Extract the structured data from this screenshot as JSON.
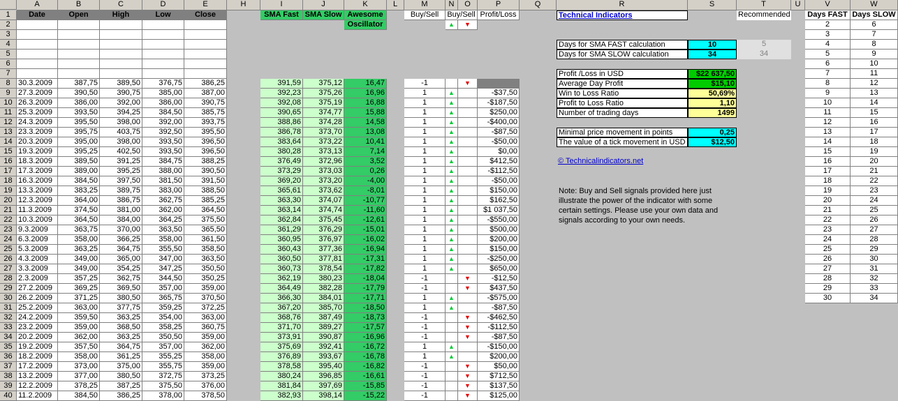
{
  "column_letters": [
    "A",
    "B",
    "C",
    "D",
    "E",
    "",
    "H",
    "I",
    "J",
    "K",
    "L",
    "M",
    "N",
    "O",
    "P",
    "Q",
    "R",
    "S",
    "T",
    "U",
    "V",
    "W"
  ],
  "price_headers": [
    "Date",
    "Open",
    "High",
    "Low",
    "Close"
  ],
  "indicator_headers": {
    "sma_fast": "SMA Fast",
    "sma_slow": "SMA Slow",
    "ao_line1": "Awesome",
    "ao_line2": "Oscillator",
    "buy_sell": "Buy/Sell",
    "buy_sell2": "Buy/Sell",
    "profit_loss": "Profit/Loss"
  },
  "days_headers": {
    "fast": "Days FAST",
    "slow": "Days SLOW"
  },
  "rows": [
    {
      "date": "30.3.2009",
      "open": "387,75",
      "high": "389,50",
      "low": "376,75",
      "close": "386,25",
      "fast": "391,59",
      "slow": "375,12",
      "ao": "16,47",
      "bs": "-1",
      "sig": "dn",
      "pl": ""
    },
    {
      "date": "27.3.2009",
      "open": "390,50",
      "high": "390,75",
      "low": "385,00",
      "close": "387,00",
      "fast": "392,23",
      "slow": "375,26",
      "ao": "16,96",
      "bs": "1",
      "sig": "up",
      "pl": "-$37,50"
    },
    {
      "date": "26.3.2009",
      "open": "386,00",
      "high": "392,00",
      "low": "386,00",
      "close": "390,75",
      "fast": "392,08",
      "slow": "375,19",
      "ao": "16,88",
      "bs": "1",
      "sig": "up",
      "pl": "-$187,50"
    },
    {
      "date": "25.3.2009",
      "open": "393,50",
      "high": "394,25",
      "low": "384,50",
      "close": "385,75",
      "fast": "390,65",
      "slow": "374,77",
      "ao": "15,88",
      "bs": "1",
      "sig": "up",
      "pl": "$250,00"
    },
    {
      "date": "24.3.2009",
      "open": "395,50",
      "high": "398,00",
      "low": "392,00",
      "close": "393,75",
      "fast": "388,86",
      "slow": "374,28",
      "ao": "14,58",
      "bs": "1",
      "sig": "up",
      "pl": "-$400,00"
    },
    {
      "date": "23.3.2009",
      "open": "395,75",
      "high": "403,75",
      "low": "392,50",
      "close": "395,50",
      "fast": "386,78",
      "slow": "373,70",
      "ao": "13,08",
      "bs": "1",
      "sig": "up",
      "pl": "-$87,50"
    },
    {
      "date": "20.3.2009",
      "open": "395,00",
      "high": "398,00",
      "low": "393,50",
      "close": "396,50",
      "fast": "383,64",
      "slow": "373,22",
      "ao": "10,41",
      "bs": "1",
      "sig": "up",
      "pl": "-$50,00"
    },
    {
      "date": "19.3.2009",
      "open": "395,25",
      "high": "402,50",
      "low": "393,50",
      "close": "396,50",
      "fast": "380,28",
      "slow": "373,13",
      "ao": "7,14",
      "bs": "1",
      "sig": "up",
      "pl": "$0,00"
    },
    {
      "date": "18.3.2009",
      "open": "389,50",
      "high": "391,25",
      "low": "384,75",
      "close": "388,25",
      "fast": "376,49",
      "slow": "372,96",
      "ao": "3,52",
      "bs": "1",
      "sig": "up",
      "pl": "$412,50"
    },
    {
      "date": "17.3.2009",
      "open": "389,00",
      "high": "395,25",
      "low": "388,00",
      "close": "390,50",
      "fast": "373,29",
      "slow": "373,03",
      "ao": "0,26",
      "bs": "1",
      "sig": "up",
      "pl": "-$112,50"
    },
    {
      "date": "16.3.2009",
      "open": "384,50",
      "high": "397,50",
      "low": "381,50",
      "close": "391,50",
      "fast": "369,20",
      "slow": "373,20",
      "ao": "-4,00",
      "bs": "1",
      "sig": "up",
      "pl": "-$50,00"
    },
    {
      "date": "13.3.2009",
      "open": "383,25",
      "high": "389,75",
      "low": "383,00",
      "close": "388,50",
      "fast": "365,61",
      "slow": "373,62",
      "ao": "-8,01",
      "bs": "1",
      "sig": "up",
      "pl": "$150,00"
    },
    {
      "date": "12.3.2009",
      "open": "364,00",
      "high": "386,75",
      "low": "362,75",
      "close": "385,25",
      "fast": "363,30",
      "slow": "374,07",
      "ao": "-10,77",
      "bs": "1",
      "sig": "up",
      "pl": "$162,50"
    },
    {
      "date": "11.3.2009",
      "open": "374,50",
      "high": "381,00",
      "low": "362,00",
      "close": "364,50",
      "fast": "363,14",
      "slow": "374,74",
      "ao": "-11,60",
      "bs": "1",
      "sig": "up",
      "pl": "$1 037,50"
    },
    {
      "date": "10.3.2009",
      "open": "364,50",
      "high": "384,00",
      "low": "364,25",
      "close": "375,50",
      "fast": "362,84",
      "slow": "375,45",
      "ao": "-12,61",
      "bs": "1",
      "sig": "up",
      "pl": "-$550,00"
    },
    {
      "date": "9.3.2009",
      "open": "363,75",
      "high": "370,00",
      "low": "363,50",
      "close": "365,50",
      "fast": "361,29",
      "slow": "376,29",
      "ao": "-15,01",
      "bs": "1",
      "sig": "up",
      "pl": "$500,00"
    },
    {
      "date": "6.3.2009",
      "open": "358,00",
      "high": "366,25",
      "low": "358,00",
      "close": "361,50",
      "fast": "360,95",
      "slow": "376,97",
      "ao": "-16,02",
      "bs": "1",
      "sig": "up",
      "pl": "$200,00"
    },
    {
      "date": "5.3.2009",
      "open": "363,25",
      "high": "364,75",
      "low": "355,50",
      "close": "358,50",
      "fast": "360,43",
      "slow": "377,36",
      "ao": "-16,94",
      "bs": "1",
      "sig": "up",
      "pl": "$150,00"
    },
    {
      "date": "4.3.2009",
      "open": "349,00",
      "high": "365,00",
      "low": "347,00",
      "close": "363,50",
      "fast": "360,50",
      "slow": "377,81",
      "ao": "-17,31",
      "bs": "1",
      "sig": "up",
      "pl": "-$250,00"
    },
    {
      "date": "3.3.2009",
      "open": "349,00",
      "high": "354,25",
      "low": "347,25",
      "close": "350,50",
      "fast": "360,73",
      "slow": "378,54",
      "ao": "-17,82",
      "bs": "1",
      "sig": "up",
      "pl": "$650,00"
    },
    {
      "date": "2.3.2009",
      "open": "357,25",
      "high": "362,75",
      "low": "344,50",
      "close": "350,25",
      "fast": "362,19",
      "slow": "380,23",
      "ao": "-18,04",
      "bs": "-1",
      "sig": "dn",
      "pl": "-$12,50"
    },
    {
      "date": "27.2.2009",
      "open": "369,25",
      "high": "369,50",
      "low": "357,00",
      "close": "359,00",
      "fast": "364,49",
      "slow": "382,28",
      "ao": "-17,79",
      "bs": "-1",
      "sig": "dn",
      "pl": "$437,50"
    },
    {
      "date": "26.2.2009",
      "open": "371,25",
      "high": "380,50",
      "low": "365,75",
      "close": "370,50",
      "fast": "366,30",
      "slow": "384,01",
      "ao": "-17,71",
      "bs": "1",
      "sig": "up",
      "pl": "-$575,00"
    },
    {
      "date": "25.2.2009",
      "open": "363,00",
      "high": "377,75",
      "low": "359,25",
      "close": "372,25",
      "fast": "367,20",
      "slow": "385,70",
      "ao": "-18,50",
      "bs": "1",
      "sig": "up",
      "pl": "-$87,50"
    },
    {
      "date": "24.2.2009",
      "open": "359,50",
      "high": "363,25",
      "low": "354,00",
      "close": "363,00",
      "fast": "368,76",
      "slow": "387,49",
      "ao": "-18,73",
      "bs": "-1",
      "sig": "dn",
      "pl": "-$462,50"
    },
    {
      "date": "23.2.2009",
      "open": "359,00",
      "high": "368,50",
      "low": "358,25",
      "close": "360,75",
      "fast": "371,70",
      "slow": "389,27",
      "ao": "-17,57",
      "bs": "-1",
      "sig": "dn",
      "pl": "-$112,50"
    },
    {
      "date": "20.2.2009",
      "open": "362,00",
      "high": "363,25",
      "low": "350,50",
      "close": "359,00",
      "fast": "373,91",
      "slow": "390,87",
      "ao": "-16,96",
      "bs": "-1",
      "sig": "dn",
      "pl": "-$87,50"
    },
    {
      "date": "19.2.2009",
      "open": "357,50",
      "high": "364,75",
      "low": "357,00",
      "close": "362,00",
      "fast": "375,69",
      "slow": "392,41",
      "ao": "-16,72",
      "bs": "1",
      "sig": "up",
      "pl": "-$150,00"
    },
    {
      "date": "18.2.2009",
      "open": "358,00",
      "high": "361,25",
      "low": "355,25",
      "close": "358,00",
      "fast": "376,89",
      "slow": "393,67",
      "ao": "-16,78",
      "bs": "1",
      "sig": "up",
      "pl": "$200,00"
    },
    {
      "date": "17.2.2009",
      "open": "373,00",
      "high": "375,00",
      "low": "355,75",
      "close": "359,00",
      "fast": "378,58",
      "slow": "395,40",
      "ao": "-16,82",
      "bs": "-1",
      "sig": "dn",
      "pl": "$50,00"
    },
    {
      "date": "13.2.2009",
      "open": "377,00",
      "high": "380,50",
      "low": "372,75",
      "close": "373,25",
      "fast": "380,24",
      "slow": "396,85",
      "ao": "-16,61",
      "bs": "-1",
      "sig": "dn",
      "pl": "$712,50"
    },
    {
      "date": "12.2.2009",
      "open": "378,25",
      "high": "387,25",
      "low": "375,50",
      "close": "376,00",
      "fast": "381,84",
      "slow": "397,69",
      "ao": "-15,85",
      "bs": "-1",
      "sig": "dn",
      "pl": "$137,50"
    },
    {
      "date": "11.2.2009",
      "open": "384,50",
      "high": "386,25",
      "low": "378,00",
      "close": "378,50",
      "fast": "382,93",
      "slow": "398,14",
      "ao": "-15,22",
      "bs": "-1",
      "sig": "dn",
      "pl": "$125,00"
    }
  ],
  "panel": {
    "title": "Technical Indicators",
    "recommended_label": "Recommended",
    "days_fast_label": "Days for SMA FAST calculation",
    "days_fast_value": "10",
    "days_fast_rec": "5",
    "days_slow_label": "Days for SMA SLOW calculation",
    "days_slow_value": "34",
    "days_slow_rec": "34",
    "stats": [
      {
        "label": "Profit /Loss in USD",
        "value": "$22 637,50",
        "color": "#00cc00"
      },
      {
        "label": "Average Day Profit",
        "value": "$15,10",
        "color": "#00cc00"
      },
      {
        "label": "Win to Loss Ratio",
        "value": "50,69%",
        "color": "#ffff99"
      },
      {
        "label": "Profit to Loss Ratio",
        "value": "1,10",
        "color": "#ffff99"
      },
      {
        "label": "Number of trading days",
        "value": "1499",
        "color": "#ffff99"
      }
    ],
    "min_move_label": "Minimal price movement in points",
    "min_move_value": "0,25",
    "tick_label": "The value of a tick movement in USD",
    "tick_value": "$12,50",
    "link": "© Technicalindicators.net",
    "note": "Note: Buy and Sell signals provided here just illustrate the power of the indicator with some certain settings. Please use your own data and signals according to your own needs."
  },
  "days_table": [
    [
      "2",
      "6"
    ],
    [
      "3",
      "7"
    ],
    [
      "4",
      "8"
    ],
    [
      "5",
      "9"
    ],
    [
      "6",
      "10"
    ],
    [
      "7",
      "11"
    ],
    [
      "8",
      "12"
    ],
    [
      "9",
      "13"
    ],
    [
      "10",
      "14"
    ],
    [
      "11",
      "15"
    ],
    [
      "12",
      "16"
    ],
    [
      "13",
      "17"
    ],
    [
      "14",
      "18"
    ],
    [
      "15",
      "19"
    ],
    [
      "16",
      "20"
    ],
    [
      "17",
      "21"
    ],
    [
      "18",
      "22"
    ],
    [
      "19",
      "23"
    ],
    [
      "20",
      "24"
    ],
    [
      "21",
      "25"
    ],
    [
      "22",
      "26"
    ],
    [
      "23",
      "27"
    ],
    [
      "24",
      "28"
    ],
    [
      "25",
      "29"
    ],
    [
      "26",
      "30"
    ],
    [
      "27",
      "31"
    ],
    [
      "28",
      "32"
    ],
    [
      "29",
      "33"
    ],
    [
      "30",
      "34"
    ]
  ],
  "colors": {
    "accent_green": "#33cc66",
    "light_green": "#ccffcc",
    "cyan": "#00ffff",
    "yellow": "#ffff99",
    "link_blue": "#0000cc"
  }
}
